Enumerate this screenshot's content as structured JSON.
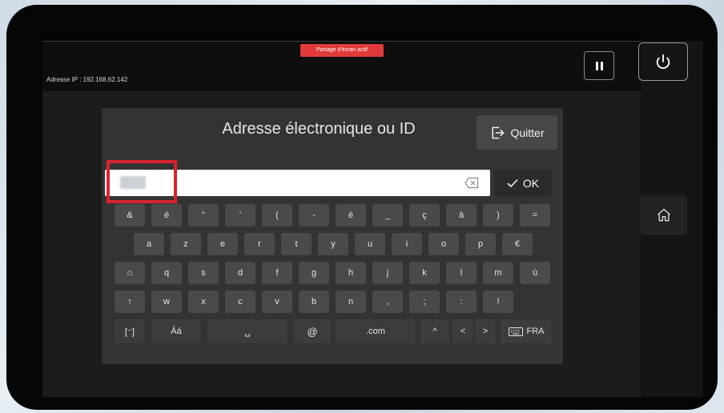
{
  "status": {
    "screen_share_badge": "Partage d'écran actif",
    "ip_label": "Adresse IP : 192.168.62.142"
  },
  "controls": {
    "pause_icon": "pause-icon",
    "power_icon": "power-icon",
    "home_icon": "home-icon"
  },
  "dialog": {
    "title": "Adresse électronique ou ID",
    "quit_label": "Quitter",
    "input_value": "",
    "ok_label": "OK"
  },
  "keyboard": {
    "row1": [
      "&",
      "é",
      "\"",
      "'",
      "(",
      "-",
      "è",
      "_",
      "ç",
      "à",
      ")",
      "="
    ],
    "row2": [
      "a",
      "z",
      "e",
      "r",
      "t",
      "y",
      "u",
      "i",
      "o",
      "p",
      "€"
    ],
    "row3": [
      "⌂",
      "q",
      "s",
      "d",
      "f",
      "g",
      "h",
      "j",
      "k",
      "l",
      "m",
      "ù"
    ],
    "row4": [
      "↑",
      "w",
      "x",
      "c",
      "v",
      "b",
      "n",
      ",",
      ";",
      ":",
      "!"
    ],
    "row5": {
      "bracket": "[⁻]",
      "accent": "Áá",
      "space": "␣",
      "at": "@",
      "com": ".com",
      "up": "^",
      "left": "<",
      "right": ">",
      "language": "FRA"
    }
  },
  "colors": {
    "accent_red": "#e23a3a",
    "highlight_red": "#d9232f"
  }
}
